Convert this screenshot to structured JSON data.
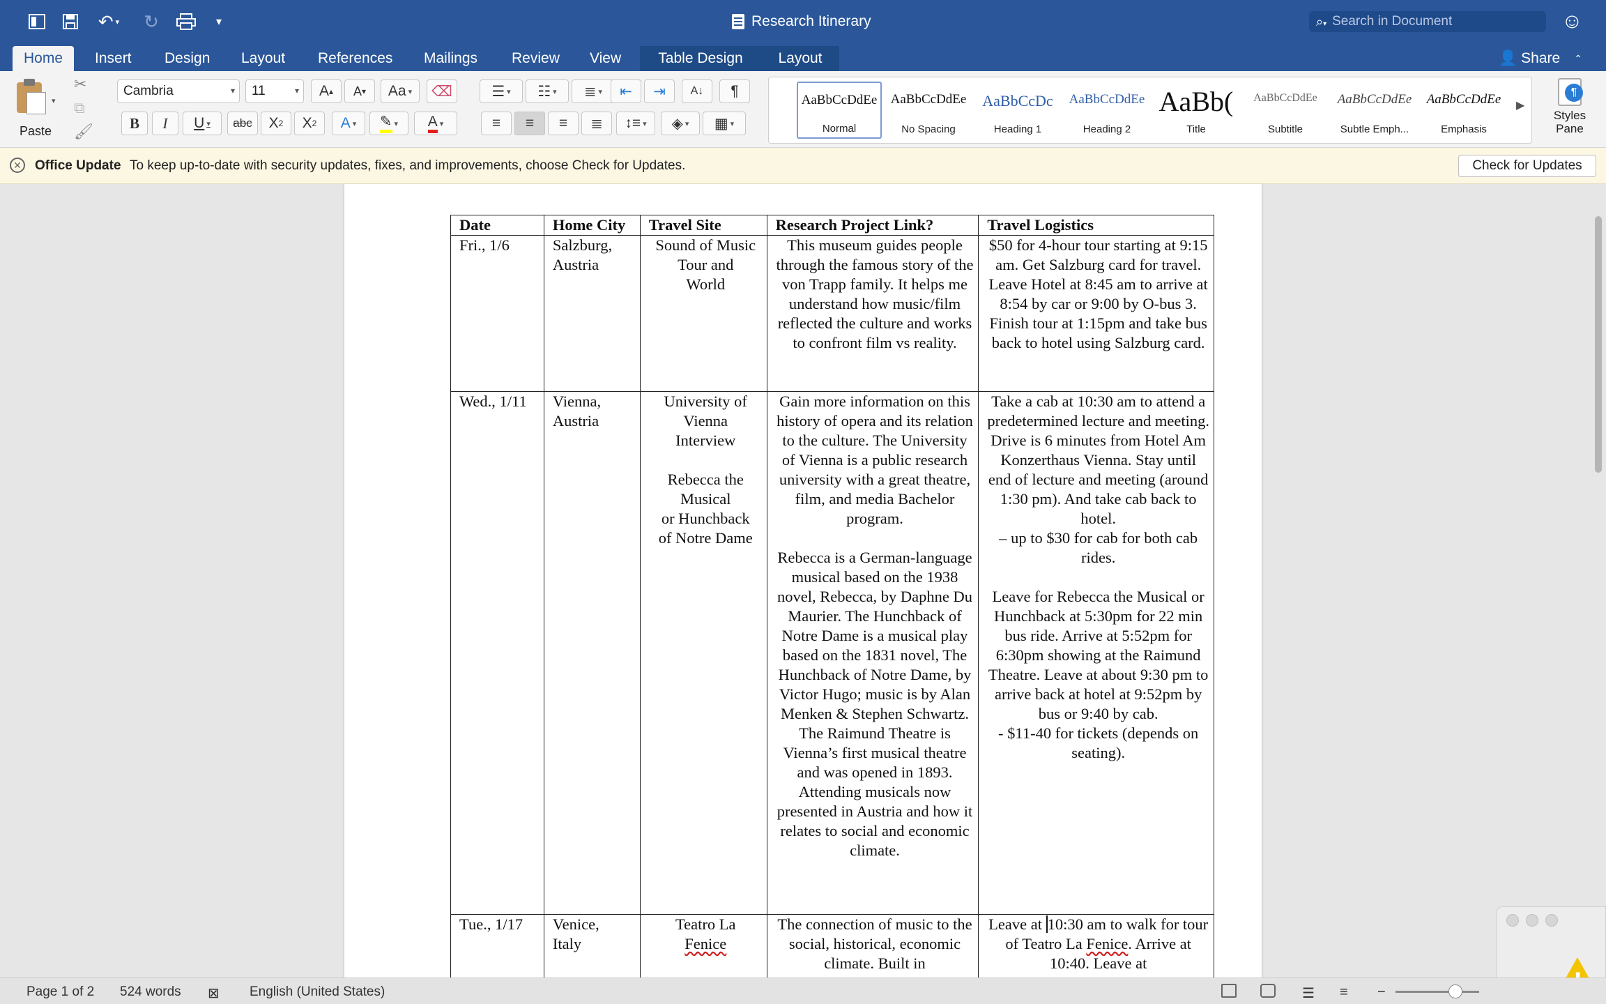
{
  "window": {
    "title": "Research Itinerary"
  },
  "quick_access": {
    "icons": [
      "sidebar-icon",
      "save-icon",
      "undo-icon",
      "redo-icon",
      "print-icon",
      "customize-icon"
    ]
  },
  "search": {
    "placeholder": "Search in Document"
  },
  "tabs": [
    "Home",
    "Insert",
    "Design",
    "Layout",
    "References",
    "Mailings",
    "Review",
    "View",
    "Table Design",
    "Layout"
  ],
  "active_tab": "Home",
  "share_label": "Share",
  "ribbon": {
    "paste_label": "Paste",
    "font_name": "Cambria",
    "font_size": "11",
    "styles": [
      {
        "preview": "AaBbCcDdEe",
        "name": "Normal"
      },
      {
        "preview": "AaBbCcDdEe",
        "name": "No Spacing"
      },
      {
        "preview": "AaBbCcDc",
        "name": "Heading 1"
      },
      {
        "preview": "AaBbCcDdEe",
        "name": "Heading 2"
      },
      {
        "preview": "AaBb(",
        "name": "Title"
      },
      {
        "preview": "AaBbCcDdEe",
        "name": "Subtitle"
      },
      {
        "preview": "AaBbCcDdEe",
        "name": "Subtle Emph..."
      },
      {
        "preview": "AaBbCcDdEe",
        "name": "Emphasis"
      }
    ],
    "styles_pane_label": "Styles Pane",
    "colors": {
      "highlight": "#ffff00",
      "font_color": "#e02020",
      "accent": "#2b579a"
    }
  },
  "notification": {
    "title": "Office Update",
    "message": "To keep up-to-date with security updates, fixes, and improvements, choose Check for Updates.",
    "button": "Check for Updates"
  },
  "table": {
    "headers": [
      "Date",
      "Home City",
      "Travel Site",
      "Research Project Link?",
      "Travel Logistics"
    ],
    "rows": [
      {
        "date": "Fri., 1/6",
        "city": "Salzburg,\nAustria",
        "site": "Sound of Music\nTour and\nWorld",
        "link": "This museum guides people through the famous story of the von Trapp family. It helps me understand how music/film reflected the culture and works to confront film vs reality.",
        "logistics": "$50 for 4-hour tour starting at 9:15 am. Get Salzburg card for travel. Leave Hotel at 8:45 am to arrive at 8:54 by car or 9:00 by O-bus 3. Finish tour at 1:15pm and take bus back to hotel using Salzburg card."
      },
      {
        "date": "Wed., 1/11",
        "city": "Vienna,\nAustria",
        "site": "University of\nVienna\nInterview\n\nRebecca the\nMusical\nor Hunchback\nof Notre Dame",
        "link": "Gain more information on this history of opera and its relation to the culture. The University of Vienna is a public research university with a great theatre, film, and media Bachelor program.\n\nRebecca is a German-language musical based on the 1938 novel, Rebecca, by Daphne Du Maurier. The Hunchback of Notre Dame is a musical play based on the 1831 novel, The Hunchback of Notre Dame, by Victor Hugo; music is by Alan Menken & Stephen Schwartz. The Raimund Theatre is Vienna’s first musical theatre and was opened in 1893. Attending musicals now presented in Austria and how it relates to social and economic climate.",
        "logistics": "Take a cab at 10:30 am to attend a predetermined lecture and meeting. Drive is 6 minutes from Hotel Am Konzerthaus Vienna. Stay until end of lecture and meeting (around 1:30 pm). And take cab back to hotel.\n– up to $30 for cab for both cab rides.\n\nLeave for Rebecca the Musical or Hunchback at 5:30pm for 22 min bus ride. Arrive at 5:52pm for 6:30pm showing at the Raimund Theatre. Leave at about 9:30 pm to arrive back at hotel at 9:52pm by bus or 9:40 by cab.\n- $11-40 for tickets (depends on seating)."
      },
      {
        "date": "Tue., 1/17",
        "city": "Venice,\nItaly",
        "site_line1": "Teatro La",
        "site_line2": "Fenice",
        "link": "The connection of music to the social, historical, economic climate. Built in",
        "logistics_pre": "Leave at ",
        "logistics_post": "10:30 am to walk for tour of Teatro La ",
        "logistics_spell": "Fenice",
        "logistics_end": ". Arrive at 10:40. Leave at"
      }
    ]
  },
  "status": {
    "page": "Page 1 of 2",
    "words": "524 words",
    "language": "English (United States)"
  }
}
